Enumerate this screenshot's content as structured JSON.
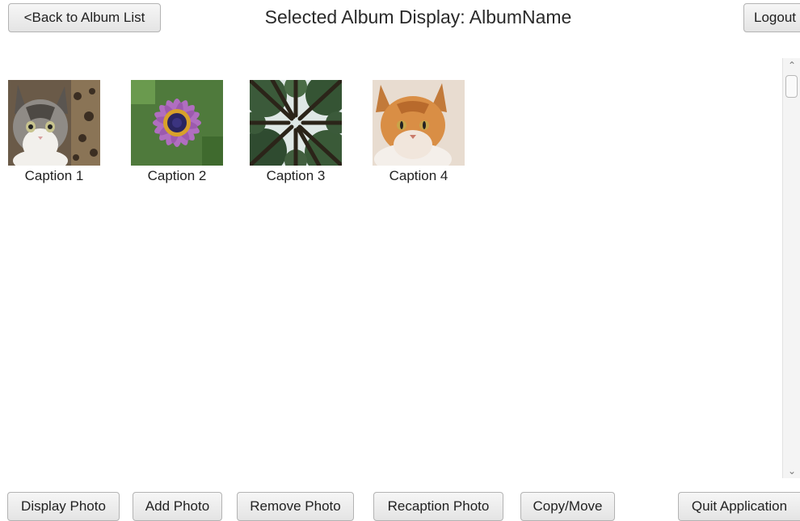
{
  "header": {
    "back_label": "<Back to Album List",
    "title": "Selected Album Display: AlbumName",
    "logout_label": "Logout"
  },
  "photos": [
    {
      "caption": "Caption 1",
      "icon": "tabby-cat-photo"
    },
    {
      "caption": "Caption 2",
      "icon": "purple-flower-photo"
    },
    {
      "caption": "Caption 3",
      "icon": "forest-canopy-photo"
    },
    {
      "caption": "Caption 4",
      "icon": "orange-cat-photo"
    }
  ],
  "toolbar": {
    "display_label": "Display Photo",
    "add_label": "Add Photo",
    "remove_label": "Remove Photo",
    "recaption_label": "Recaption Photo",
    "copymove_label": "Copy/Move",
    "quit_label": "Quit Application"
  },
  "colors": {
    "button_bg": "#ececec",
    "button_border": "#b3b3b3",
    "background": "#ffffff"
  }
}
